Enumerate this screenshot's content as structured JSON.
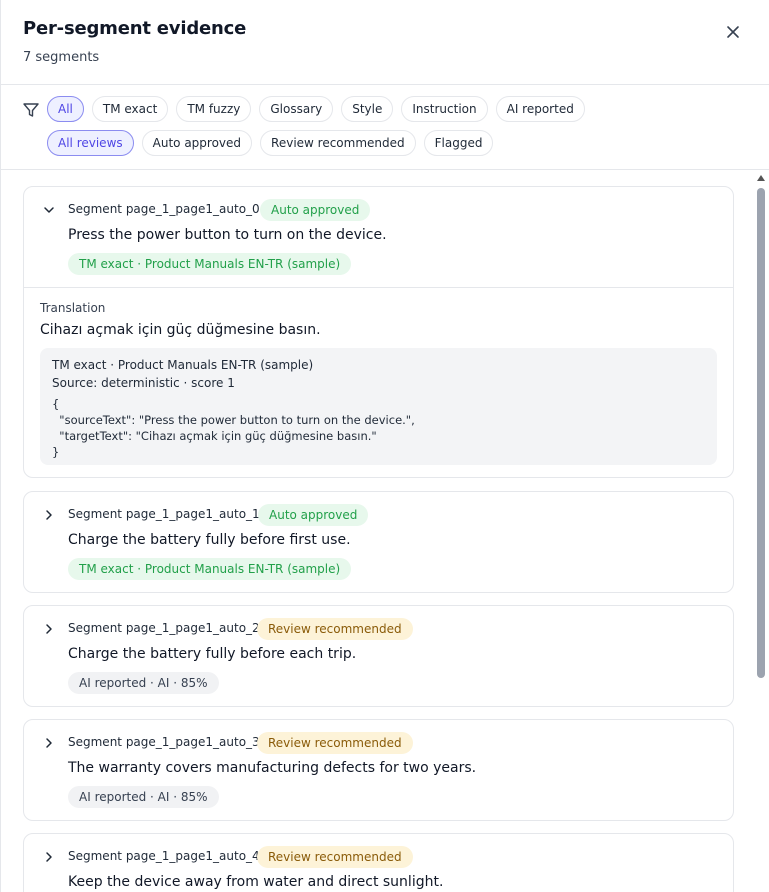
{
  "header": {
    "title": "Per-segment evidence",
    "subtitle": "7 segments"
  },
  "filters": {
    "type_chips": [
      "All",
      "TM exact",
      "TM fuzzy",
      "Glossary",
      "Style",
      "Instruction",
      "AI reported"
    ],
    "type_active": "All",
    "review_chips": [
      "All reviews",
      "Auto approved",
      "Review recommended",
      "Flagged"
    ],
    "review_active": "All reviews"
  },
  "segments": [
    {
      "label": "Segment page_1_page1_auto_0",
      "status": "Auto approved",
      "source": "Press the power button to turn on the device.",
      "tag": "TM exact · Product Manuals EN-TR (sample)",
      "expanded": true,
      "translation_label": "Translation",
      "translation": "Cihazı açmak için güç düğmesine basın.",
      "evidence_title": "TM exact · Product Manuals EN-TR (sample)",
      "evidence_source": "Source: deterministic · score 1",
      "evidence_json": "{\n  \"sourceText\": \"Press the power button to turn on the device.\",\n  \"targetText\": \"Cihazı açmak için güç düğmesine basın.\"\n}"
    },
    {
      "label": "Segment page_1_page1_auto_1",
      "status": "Auto approved",
      "source": "Charge the battery fully before first use.",
      "tag": "TM exact · Product Manuals EN-TR (sample)",
      "expanded": false
    },
    {
      "label": "Segment page_1_page1_auto_2",
      "status": "Review recommended",
      "source": "Charge the battery fully before each trip.",
      "tag": "AI reported · AI · 85%",
      "expanded": false
    },
    {
      "label": "Segment page_1_page1_auto_3",
      "status": "Review recommended",
      "source": "The warranty covers manufacturing defects for two years.",
      "tag": "AI reported · AI · 85%",
      "expanded": false
    },
    {
      "label": "Segment page_1_page1_auto_4",
      "status": "Review recommended",
      "source": "Keep the device away from water and direct sunlight.",
      "tag": "",
      "expanded": false
    }
  ],
  "colors": {
    "accent": "#4f46e5",
    "auto_bg": "#e7f8ec",
    "auto_fg": "#22a04a",
    "review_bg": "#fdf3d8",
    "review_fg": "#8a5b09"
  },
  "icons": [
    "close-icon",
    "filter-icon",
    "chevron-down-icon",
    "chevron-right-icon"
  ]
}
